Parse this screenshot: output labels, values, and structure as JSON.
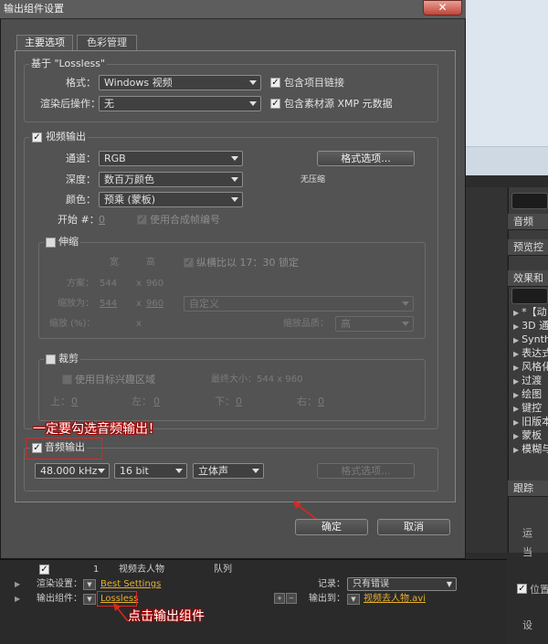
{
  "dialog": {
    "title": "输出组件设置",
    "close_glyph": "✕",
    "tabs": [
      "主要选项",
      "色彩管理"
    ],
    "based_on": "基于 \"Lossless\"",
    "format_label": "格式：",
    "format_value": "Windows 视频",
    "post_render_label": "渲染后操作：",
    "post_render_value": "无",
    "include_project_link": "包含项目链接",
    "include_xmp": "包含素材源 XMP 元数据",
    "video_output": {
      "title": "视频输出",
      "channels_label": "通道：",
      "channels_value": "RGB",
      "depth_label": "深度：",
      "depth_value": "数百万颜色",
      "color_label": "颜色：",
      "color_value": "预乘 (蒙板)",
      "format_options_btn": "格式选项...",
      "uncompressed": "无压缩",
      "start_label": "开始 #：",
      "start_value": "0",
      "use_comp_frame": "使用合成帧编号"
    },
    "resize": {
      "title": "伸缩",
      "width_hdr": "宽",
      "height_hdr": "高",
      "lock_aspect": "纵横比以 17：30 锁定",
      "rendering_at_label": "方案：",
      "rendering_at_w": "544",
      "x1": "x",
      "rendering_at_h": "960",
      "resize_to_label": "缩放为：",
      "resize_to_w": "544",
      "x2": "x",
      "resize_to_h": "960",
      "custom": "自定义",
      "resize_pct_label": "缩放 (%)：",
      "x3": "x",
      "quality_label": "缩放品质：",
      "quality_value": "高"
    },
    "crop": {
      "title": "裁剪",
      "use_roi": "使用目标兴趣区域",
      "final_size": "最终大小：544 x 960",
      "top_label": "上：",
      "top_value": "0",
      "left_label": "左：",
      "left_value": "0",
      "bottom_label": "下：",
      "bottom_value": "0",
      "right_label": "右：",
      "right_value": "0"
    },
    "audio": {
      "title": "音频输出",
      "rate": "48.000 kHz",
      "bits": "16 bit",
      "channels": "立体声",
      "format_options_btn": "格式选项..."
    },
    "ok": "确定",
    "cancel": "取消"
  },
  "annotations": {
    "audio_note": "一定要勾选音频输出！",
    "output_note": "点击输出组件"
  },
  "render_queue": {
    "row_num": "1",
    "row_name": "视频去人物",
    "row_status": "队列",
    "render_settings_label": "渲染设置：",
    "render_settings_value": "Best Settings",
    "log_label": "记录：",
    "log_value": "只有错误",
    "output_module_label": "输出组件：",
    "output_module_value": "Lossless",
    "output_to_label": "输出到：",
    "output_to_value": "视频去人物.avi",
    "plus": "+",
    "minus": "−"
  },
  "right_panel": {
    "audio": "音频",
    "preview": "预览控",
    "effects": "效果和",
    "items": [
      "*【动",
      "3D 通",
      "Synthe",
      "表达式",
      "风格化",
      "过渡",
      "绘图",
      "键控",
      "旧版本",
      "蒙板",
      "模糊与"
    ],
    "tracker": "跟踪",
    "tr_items": [
      "运",
      "当",
      "位置",
      "设"
    ]
  }
}
